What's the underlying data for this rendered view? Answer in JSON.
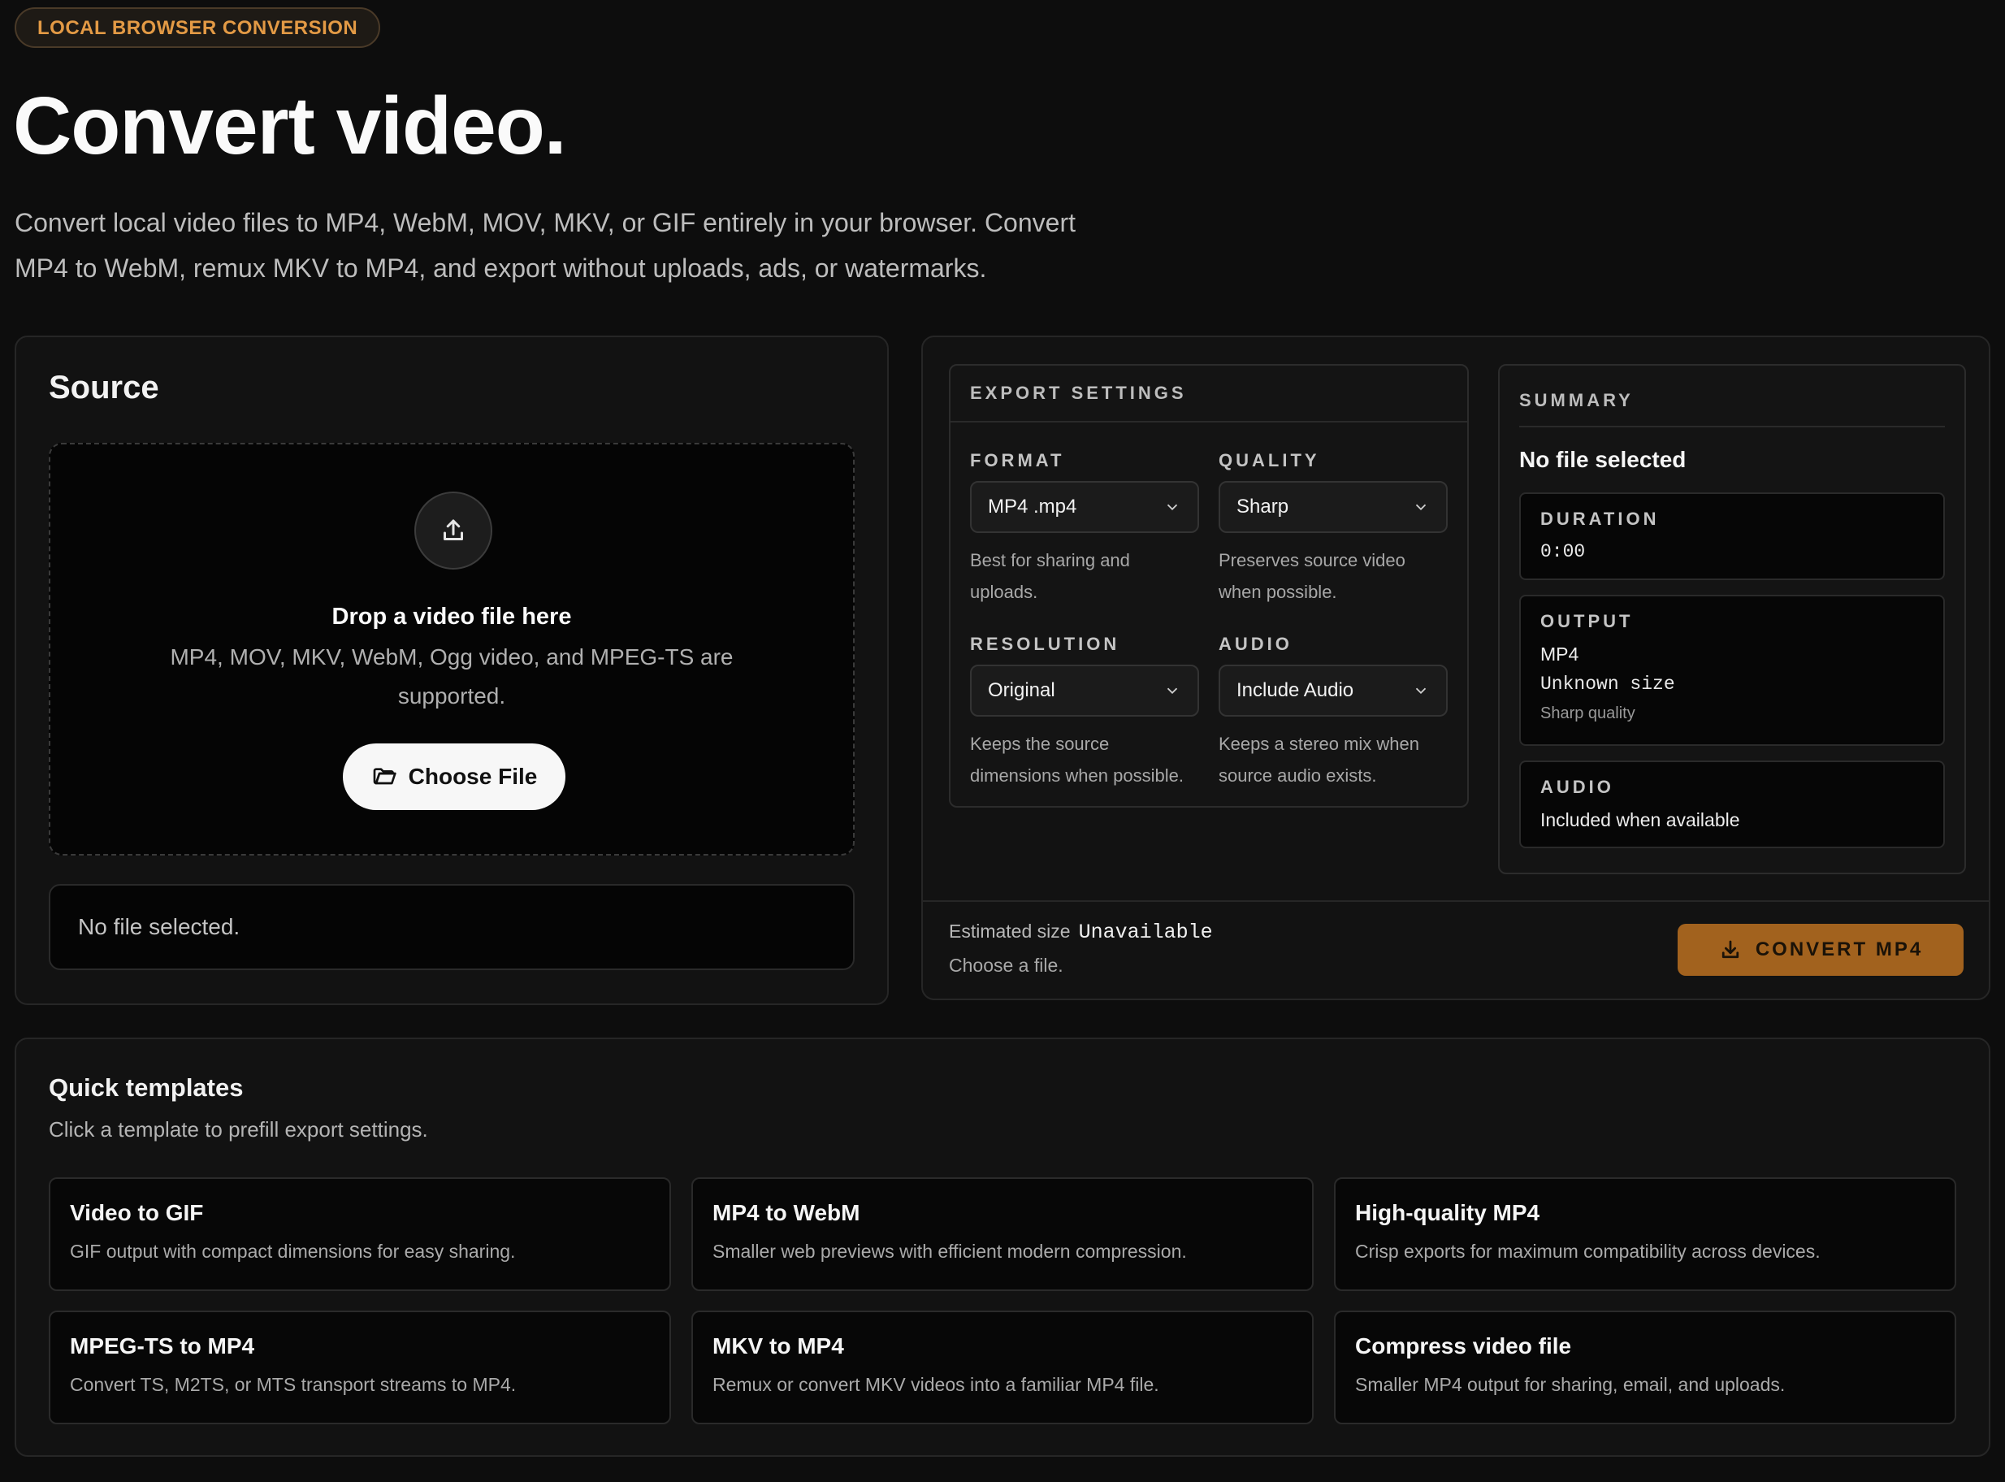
{
  "badge": "LOCAL BROWSER CONVERSION",
  "title": "Convert video.",
  "intro": "Convert local video files to MP4, WebM, MOV, MKV, or GIF entirely in your browser. Convert MP4 to WebM, remux MKV to MP4, and export without uploads, ads, or watermarks.",
  "source": {
    "heading": "Source",
    "drop_title": "Drop a video file here",
    "drop_sub": "MP4, MOV, MKV, WebM, Ogg video, and MPEG-TS are supported.",
    "choose_label": "Choose File",
    "status": "No file selected."
  },
  "settings": {
    "heading": "EXPORT SETTINGS",
    "format": {
      "label": "FORMAT",
      "value": "MP4 .mp4",
      "help": "Best for sharing and uploads."
    },
    "quality": {
      "label": "QUALITY",
      "value": "Sharp",
      "help": "Preserves source video when possible."
    },
    "resolution": {
      "label": "RESOLUTION",
      "value": "Original",
      "help": "Keeps the source dimensions when possible."
    },
    "audio": {
      "label": "AUDIO",
      "value": "Include Audio",
      "help": "Keeps a stereo mix when source audio exists."
    }
  },
  "summary": {
    "heading": "SUMMARY",
    "file": "No file selected",
    "duration_label": "DURATION",
    "duration": "0:00",
    "output_label": "OUTPUT",
    "output_format": "MP4",
    "output_size": "Unknown size",
    "output_quality": "Sharp quality",
    "audio_label": "AUDIO",
    "audio_value": "Included when available"
  },
  "footer": {
    "est_label": "Estimated size",
    "est_value": "Unavailable",
    "est_sub": "Choose a file.",
    "convert_label": "CONVERT MP4"
  },
  "templates": {
    "heading": "Quick templates",
    "sub": "Click a template to prefill export settings.",
    "items": [
      {
        "title": "Video to GIF",
        "desc": "GIF output with compact dimensions for easy sharing."
      },
      {
        "title": "MP4 to WebM",
        "desc": "Smaller web previews with efficient modern compression."
      },
      {
        "title": "High-quality MP4",
        "desc": "Crisp exports for maximum compatibility across devices."
      },
      {
        "title": "MPEG-TS to MP4",
        "desc": "Convert TS, M2TS, or MTS transport streams to MP4."
      },
      {
        "title": "MKV to MP4",
        "desc": "Remux or convert MKV videos into a familiar MP4 file."
      },
      {
        "title": "Compress video file",
        "desc": "Smaller MP4 output for sharing, email, and uploads."
      }
    ]
  },
  "colors": {
    "accent": "#a2621e",
    "badge_text": "#e39a45",
    "background": "#0d0d0d"
  }
}
